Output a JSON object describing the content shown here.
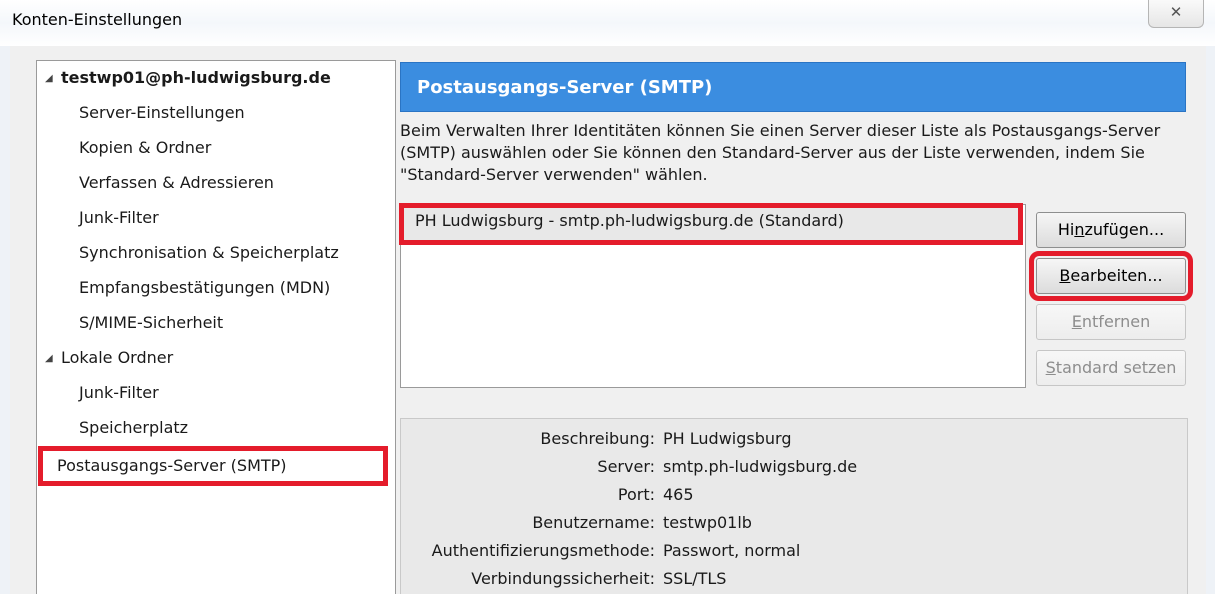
{
  "window": {
    "title": "Konten-Einstellungen",
    "close_glyph": "✕"
  },
  "sidebar": {
    "account": "testwp01@ph-ludwigsburg.de",
    "account_items": [
      "Server-Einstellungen",
      "Kopien & Ordner",
      "Verfassen & Adressieren",
      "Junk-Filter",
      "Synchronisation & Speicherplatz",
      "Empfangsbestätigungen (MDN)",
      "S/MIME-Sicherheit"
    ],
    "local_folders": "Lokale Ordner",
    "local_items": [
      "Junk-Filter",
      "Speicherplatz"
    ],
    "smtp": "Postausgangs-Server (SMTP)",
    "expand_glyph": "◢"
  },
  "panel": {
    "heading": "Postausgangs-Server (SMTP)",
    "description": "Beim Verwalten Ihrer Identitäten können Sie einen Server dieser Liste als Postausgangs-Server (SMTP) auswählen oder Sie können den Standard-Server aus der Liste verwenden, indem Sie \"Standard-Server verwenden\" wählen.",
    "servers": [
      "PH Ludwigsburg - smtp.ph-ludwigsburg.de (Standard)"
    ],
    "buttons": {
      "add_pre": "Hi",
      "add_key": "n",
      "add_post": "zufügen...",
      "edit_pre": "",
      "edit_key": "B",
      "edit_post": "earbeiten...",
      "remove_pre": "",
      "remove_key": "E",
      "remove_post": "ntfernen",
      "default_pre": "",
      "default_key": "S",
      "default_post": "tandard setzen"
    },
    "details": [
      {
        "label": "Beschreibung:",
        "value": "PH Ludwigsburg"
      },
      {
        "label": "Server:",
        "value": "smtp.ph-ludwigsburg.de"
      },
      {
        "label": "Port:",
        "value": "465"
      },
      {
        "label": "Benutzername:",
        "value": "testwp01lb"
      },
      {
        "label": "Authentifizierungsmethode:",
        "value": "Passwort, normal"
      },
      {
        "label": "Verbindungssicherheit:",
        "value": "SSL/TLS"
      }
    ]
  },
  "colors": {
    "header_bg": "#3b8de0",
    "highlight": "#e41c2b"
  }
}
